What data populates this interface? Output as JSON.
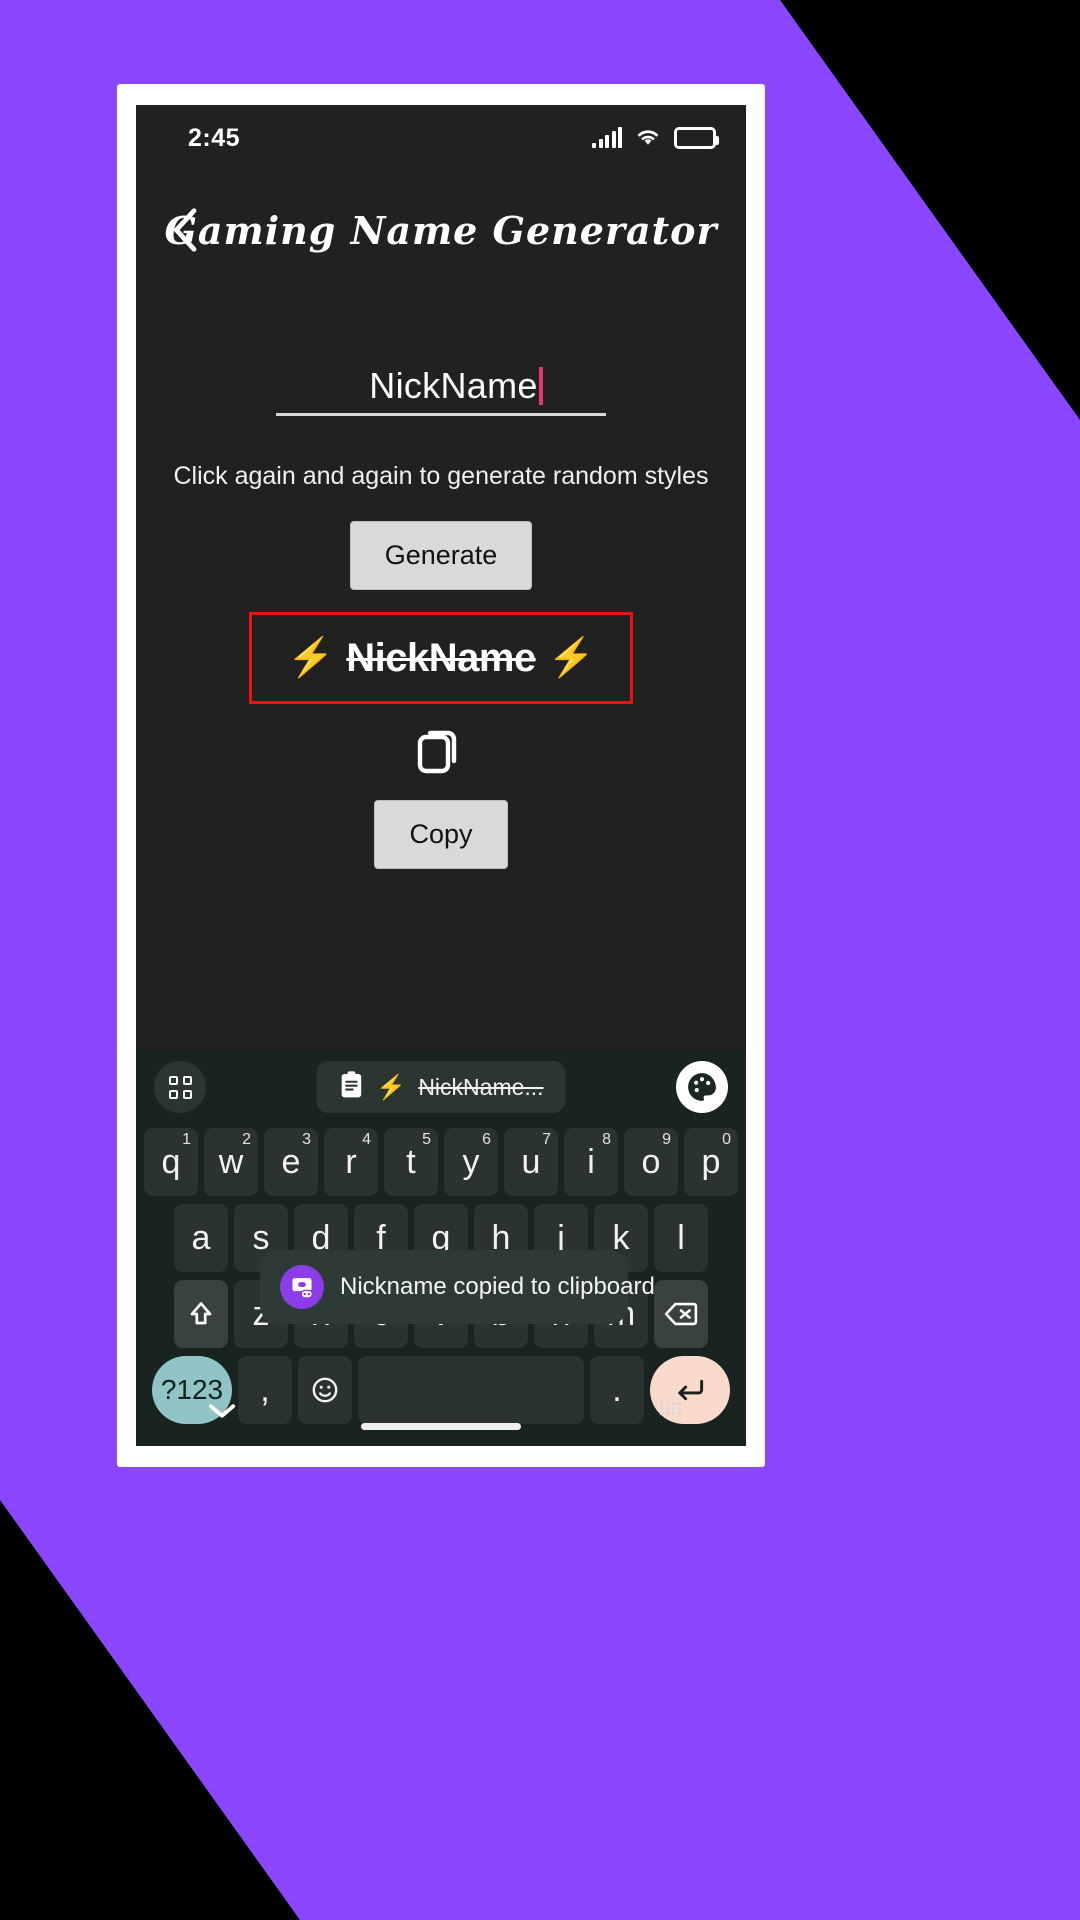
{
  "theme": {
    "backdrop_purple": "#8b46ff",
    "screen_bg": "#212121",
    "accent_red": "#ee1111",
    "caret_pink": "#e8376f",
    "keyboard_bg": "#19231f",
    "key_bg": "#2a332f",
    "chip_cyan": "#b6e4e8",
    "chip_close_peach": "#f9b497",
    "enter_peach": "#fadacb",
    "numeric_teal": "#90c4c6",
    "toast_icon_purple": "#8b3dea"
  },
  "status_bar": {
    "clock": "2:45",
    "signal_icon": "signal-bars-icon",
    "wifi_icon": "wifi-icon",
    "battery_icon": "battery-full-icon"
  },
  "app_bar": {
    "back_icon": "back-chevron-icon",
    "title": "Gaming Name Generator"
  },
  "main": {
    "input": {
      "value": "NickName",
      "placeholder": "NickName"
    },
    "hint": "Click again and again to generate random styles",
    "generate_label": "Generate",
    "result": {
      "left_bolt": "⚡",
      "text": "NickName",
      "right_bolt": "⚡"
    },
    "copy_icon": "copy-duplicate-icon",
    "copy_label": "Copy"
  },
  "paste_chip": {
    "clipboard_icon": "clipboard-icon",
    "chevron": "›",
    "close_icon": "close-x-icon"
  },
  "keyboard": {
    "suggestion_bar": {
      "grid_icon": "grid-apps-icon",
      "clipboard_icon": "clipboard-icon",
      "clip_bolt": "⚡",
      "clip_text": "NickName...",
      "palette_icon": "palette-icon"
    },
    "row1": [
      {
        "key": "q",
        "sup": "1"
      },
      {
        "key": "w",
        "sup": "2"
      },
      {
        "key": "e",
        "sup": "3"
      },
      {
        "key": "r",
        "sup": "4"
      },
      {
        "key": "t",
        "sup": "5"
      },
      {
        "key": "y",
        "sup": "6"
      },
      {
        "key": "u",
        "sup": "7"
      },
      {
        "key": "i",
        "sup": "8"
      },
      {
        "key": "o",
        "sup": "9"
      },
      {
        "key": "p",
        "sup": "0"
      }
    ],
    "row2": [
      "a",
      "s",
      "d",
      "f",
      "g",
      "h",
      "j",
      "k",
      "l"
    ],
    "row3": {
      "shift_icon": "shift-arrow-icon",
      "keys": [
        "z",
        "x",
        "c",
        "v",
        "b",
        "n",
        "m"
      ],
      "backspace_icon": "backspace-icon"
    },
    "row4": {
      "numeric_label": "?123",
      "comma": ",",
      "emoji_icon": "emoji-icon",
      "space_label": "",
      "period": ".",
      "enter_icon": "enter-return-icon"
    },
    "bottom_bar": {
      "hide_icon": "chevron-down-icon",
      "resize_icon": "keyboard-handle-icon"
    }
  },
  "toast": {
    "app_icon": "gamepad-app-icon",
    "message": "Nickname copied to clipboard"
  }
}
